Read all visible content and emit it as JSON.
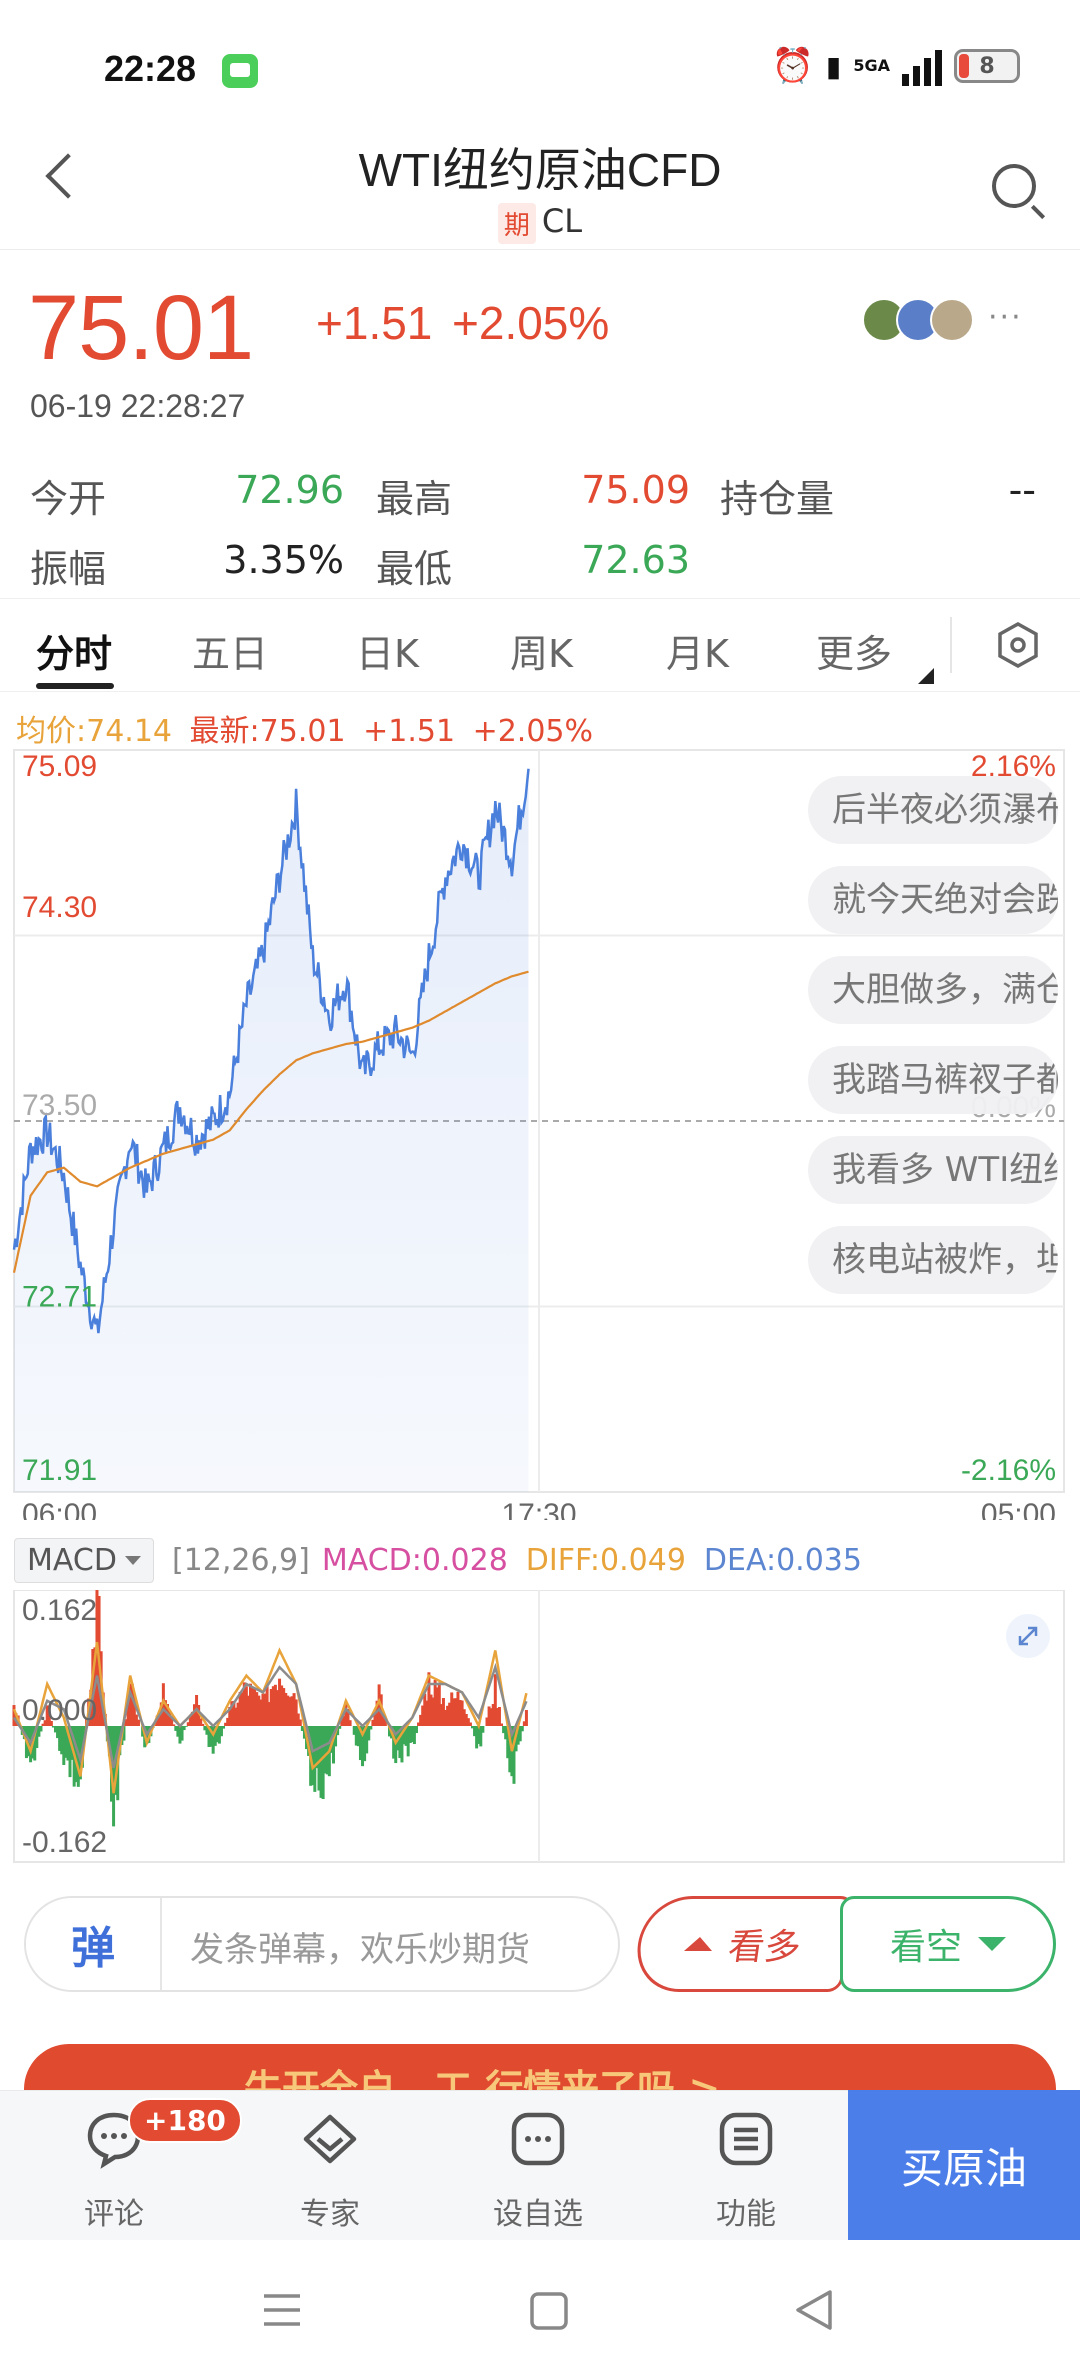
{
  "status_bar": {
    "time": "22:28",
    "network": "5GA",
    "battery": "8"
  },
  "header": {
    "title": "WTI纽约原油CFD",
    "tag": "期",
    "code": "CL"
  },
  "quote": {
    "price": "75.01",
    "change": "+1.51",
    "change_pct": "+2.05%",
    "datetime": "06-19 22:28:27",
    "more": "···"
  },
  "stats": {
    "open_label": "今开",
    "open": "72.96",
    "high_label": "最高",
    "high": "75.09",
    "oi_label": "持仓量",
    "oi": "--",
    "amp_label": "振幅",
    "amp": "3.35%",
    "low_label": "最低",
    "low": "72.63"
  },
  "tabs": [
    "分时",
    "五日",
    "日K",
    "周K",
    "月K",
    "更多"
  ],
  "legend": {
    "avg": "均价:74.14",
    "latest": "最新:75.01",
    "change": "+1.51",
    "pct": "+2.05%"
  },
  "barrage": [
    "后半夜必须瀑布",
    "就今天绝对会跌",
    "大胆做多，满仓",
    "我踏马裤衩子都",
    "我看多 WTI纽约",
    "核电站被炸，坦"
  ],
  "chart_data": {
    "type": "line",
    "series": [
      {
        "name": "最新",
        "values": [
          72.95,
          73.38,
          73.45,
          73.27,
          72.88,
          72.58,
          73.05,
          73.42,
          73.2,
          73.38,
          73.56,
          73.42,
          73.5,
          73.62,
          74.0,
          74.22,
          74.55,
          74.85,
          74.2,
          73.95,
          74.1,
          73.7,
          73.82,
          73.88,
          73.78,
          74.2,
          74.55,
          74.7,
          74.55,
          74.85,
          74.62,
          75.01
        ]
      },
      {
        "name": "均价",
        "values": [
          72.85,
          73.18,
          73.28,
          73.3,
          73.24,
          73.22,
          73.26,
          73.3,
          73.33,
          73.36,
          73.38,
          73.4,
          73.42,
          73.46,
          73.55,
          73.63,
          73.7,
          73.76,
          73.79,
          73.81,
          73.83,
          73.84,
          73.86,
          73.88,
          73.9,
          73.93,
          73.97,
          74.01,
          74.05,
          74.09,
          74.12,
          74.14
        ]
      }
    ],
    "x_ticks": [
      "06:00",
      "17:30",
      "05:00"
    ],
    "left_ticks": [
      "75.09",
      "74.30",
      "73.50",
      "72.71",
      "71.91"
    ],
    "right_ticks": [
      "2.16%",
      "0.00%",
      "-2.16%"
    ],
    "ylim": [
      71.91,
      75.09
    ],
    "prev_close": 73.5,
    "indicator": {
      "name": "MACD",
      "params": "[12,26,9]",
      "macd_label": "MACD:0.028",
      "diff_label": "DIFF:0.049",
      "dea_label": "DEA:0.035",
      "ticks": [
        "0.162",
        "0.000",
        "-0.162"
      ],
      "ylim": [
        -0.162,
        0.162
      ],
      "hist": [
        0.03,
        -0.05,
        0.02,
        -0.04,
        -0.08,
        0.16,
        -0.12,
        0.05,
        -0.03,
        0.04,
        -0.02,
        0.03,
        -0.04,
        0.02,
        0.05,
        0.03,
        0.07,
        0.04,
        -0.09,
        -0.06,
        0.03,
        -0.05,
        0.04,
        -0.04,
        -0.03,
        0.06,
        0.03,
        0.04,
        -0.03,
        0.05,
        -0.07,
        0.03
      ],
      "diff": [
        0.02,
        -0.03,
        0.05,
        0.01,
        -0.06,
        0.1,
        -0.08,
        0.06,
        -0.02,
        0.03,
        0.0,
        0.02,
        -0.01,
        0.03,
        0.06,
        0.04,
        0.09,
        0.05,
        -0.05,
        -0.03,
        0.03,
        -0.01,
        0.03,
        -0.02,
        0.01,
        0.06,
        0.05,
        0.04,
        0.0,
        0.09,
        -0.03,
        0.049
      ],
      "dea": [
        0.01,
        -0.02,
        0.03,
        0.02,
        -0.04,
        0.06,
        -0.05,
        0.04,
        -0.01,
        0.02,
        0.0,
        0.02,
        0.0,
        0.02,
        0.05,
        0.04,
        0.07,
        0.05,
        -0.03,
        -0.02,
        0.02,
        0.0,
        0.02,
        -0.01,
        0.01,
        0.05,
        0.05,
        0.04,
        0.01,
        0.07,
        -0.01,
        0.035
      ]
    }
  },
  "colors": {
    "up": "#e24a32",
    "down": "#3aa856",
    "price_line": "#4a7fdc",
    "avg_line": "#e08a2e",
    "macd": "#d64fa0",
    "diff": "#e8a33a",
    "dea": "#5d86d1"
  },
  "input": {
    "danmu_icon": "弹",
    "placeholder": "发条弹幕，欢乐炒期货",
    "bull": "看多",
    "bear": "看空"
  },
  "banner": {
    "text": "牛开全户，工 行情来了吗 >"
  },
  "bottom_nav": {
    "comment": "评论",
    "comment_badge": "+180",
    "expert": "专家",
    "watchlist": "设自选",
    "functions": "功能",
    "buy": "买原油"
  }
}
